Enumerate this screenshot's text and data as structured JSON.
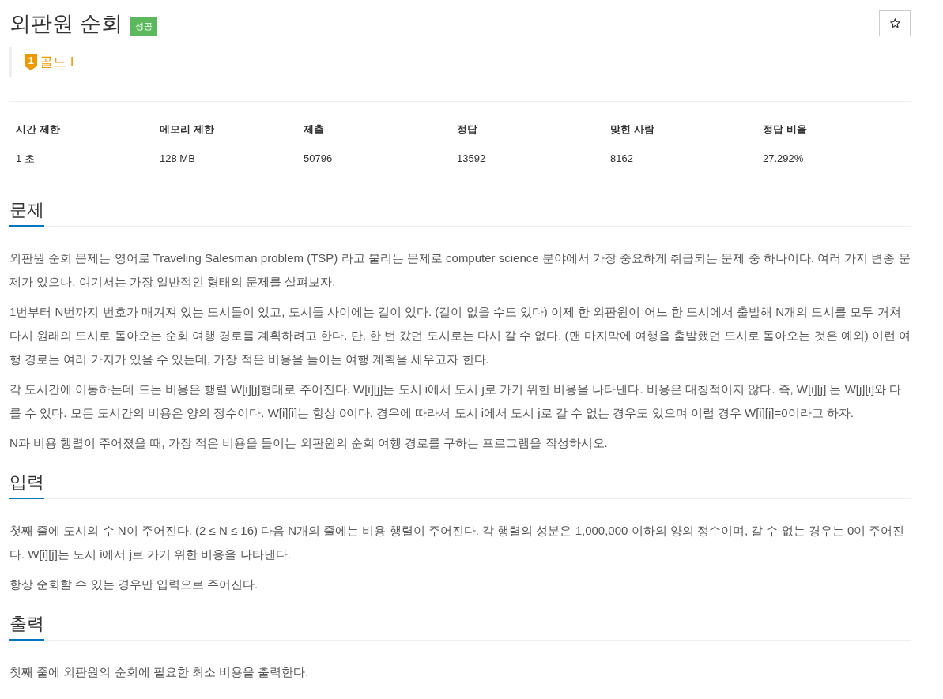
{
  "problem": {
    "title": "외판원 순회",
    "result_badge": "성공",
    "favorite_button": {
      "starred": false
    }
  },
  "tier": {
    "badge_number": "1",
    "label": "골드 I"
  },
  "stats": {
    "columns": [
      "시간 제한",
      "메모리 제한",
      "제출",
      "정답",
      "맞힌 사람",
      "정답 비율"
    ],
    "rows": [
      [
        "1 초",
        "128 MB",
        "50796",
        "13592",
        "8162",
        "27.292%"
      ]
    ]
  },
  "sections": [
    {
      "heading": "문제",
      "paragraphs": [
        "외판원 순회 문제는 영어로 Traveling Salesman problem (TSP) 라고 불리는 문제로 computer science 분야에서 가장 중요하게 취급되는 문제 중 하나이다. 여러 가지 변종 문제가 있으나, 여기서는 가장 일반적인 형태의 문제를 살펴보자.",
        "1번부터 N번까지 번호가 매겨져 있는 도시들이 있고, 도시들 사이에는 길이 있다. (길이 없을 수도 있다) 이제 한 외판원이 어느 한 도시에서 출발해 N개의 도시를 모두 거쳐 다시 원래의 도시로 돌아오는 순회 여행 경로를 계획하려고 한다. 단, 한 번 갔던 도시로는 다시 갈 수 없다. (맨 마지막에 여행을 출발했던 도시로 돌아오는 것은 예외) 이런 여행 경로는 여러 가지가 있을 수 있는데, 가장 적은 비용을 들이는 여행 계획을 세우고자 한다.",
        "각 도시간에 이동하는데 드는 비용은 행렬 W[i][j]형태로 주어진다. W[i][j]는 도시 i에서 도시 j로 가기 위한 비용을 나타낸다. 비용은 대칭적이지 않다. 즉, W[i][j] 는 W[j][i]와 다를 수 있다. 모든 도시간의 비용은 양의 정수이다. W[i][i]는 항상 0이다. 경우에 따라서 도시 i에서 도시 j로 갈 수 없는 경우도 있으며 이럴 경우 W[i][j]=0이라고 하자.",
        "N과 비용 행렬이 주어졌을 때, 가장 적은 비용을 들이는 외판원의 순회 여행 경로를 구하는 프로그램을 작성하시오."
      ]
    },
    {
      "heading": "입력",
      "paragraphs": [
        "첫째 줄에 도시의 수 N이 주어진다. (2 ≤ N ≤ 16) 다음 N개의 줄에는 비용 행렬이 주어진다. 각 행렬의 성분은 1,000,000 이하의 양의 정수이며, 갈 수 없는 경우는 0이 주어진다. W[i][j]는 도시 i에서 j로 가기 위한 비용을 나타낸다.",
        "항상 순회할 수 있는 경우만 입력으로 주어진다."
      ]
    },
    {
      "heading": "출력",
      "paragraphs": [
        "첫째 줄에 외판원의 순회에 필요한 최소 비용을 출력한다."
      ]
    }
  ]
}
